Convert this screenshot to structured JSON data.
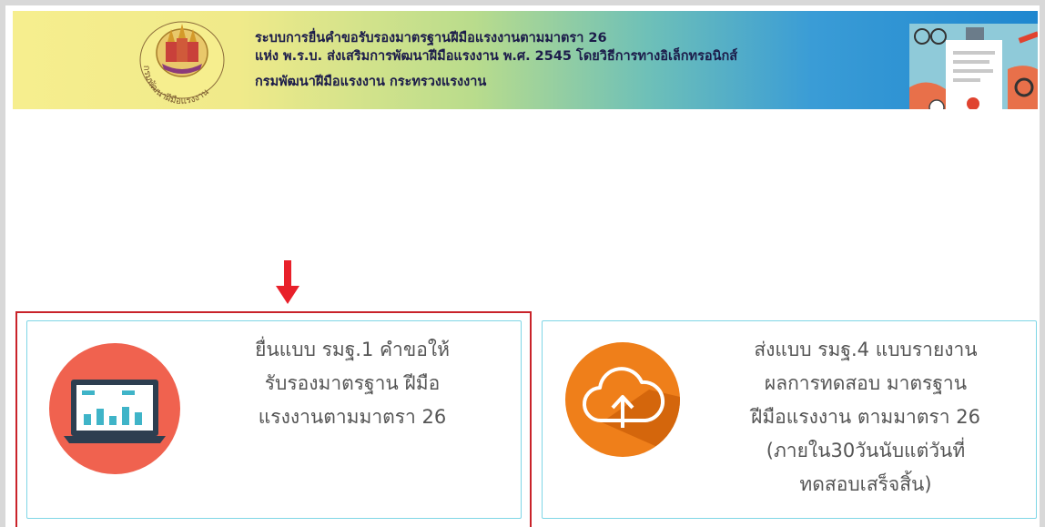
{
  "header": {
    "title_line1": "ระบบการยื่นคำขอรับรองมาตรฐานฝีมือแรงงานตามมาตรา 26",
    "title_line2": "แห่ง พ.ร.บ. ส่งเสริมการพัฒนาฝีมือแรงงาน พ.ศ. 2545 โดยวิธีการทางอิเล็กทรอนิกส์",
    "title_line3": "กรมพัฒนาฝีมือแรงงาน กระทรวงแรงงาน",
    "seal_text": "กรมพัฒนาฝีมือแรงงาน"
  },
  "cards": [
    {
      "icon": "laptop-chart-icon",
      "lines": [
        "ยื่นแบบ รมฐ.1 คำขอให้",
        "รับรองมาตรฐาน ฝีมือ",
        "แรงงานตามมาตรา 26"
      ]
    },
    {
      "icon": "cloud-upload-icon",
      "lines": [
        "ส่งแบบ รมฐ.4 แบบรายงาน",
        "ผลการทดสอบ มาตรฐาน",
        "ฝีมือแรงงาน ตามมาตรา 26",
        "(ภายใน30วันนับแต่วันที่",
        "ทดสอบเสร็จสิ้น)"
      ]
    }
  ],
  "colors": {
    "highlight_border": "#c9232a",
    "arrow": "#e8202a",
    "card_border": "#7fd6e6",
    "laptop_circle": "#f0624f",
    "cloud_circle": "#ef7f1a"
  }
}
